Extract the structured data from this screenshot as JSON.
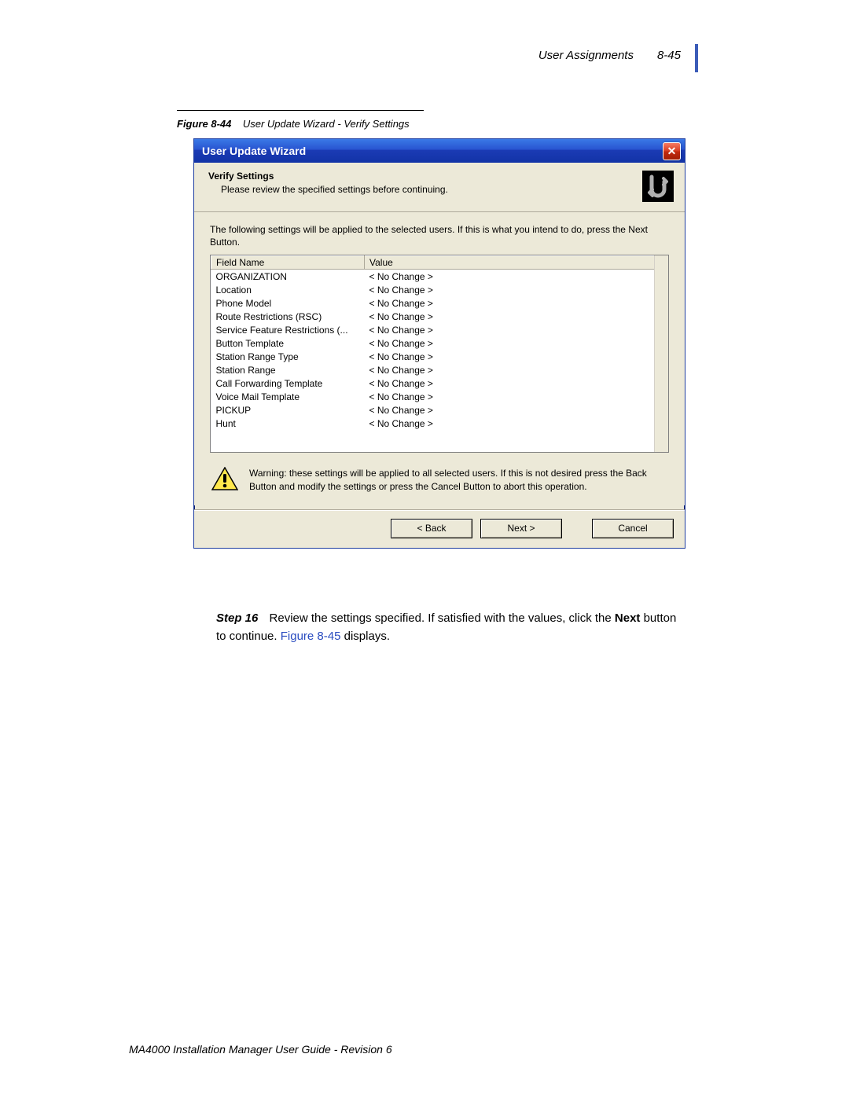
{
  "header": {
    "section": "User Assignments",
    "pageRef": "8-45"
  },
  "figure": {
    "label": "Figure 8-44",
    "caption": "User Update Wizard - Verify Settings"
  },
  "dialog": {
    "title": "User Update Wizard",
    "close_glyph": "✕",
    "heading": "Verify Settings",
    "subheading": "Please review the specified settings before continuing.",
    "intro": "The following settings will be applied to the selected users. If this is what you intend to do, press the Next Button.",
    "columns": {
      "field": "Field Name",
      "value": "Value"
    },
    "rows": [
      {
        "field": "ORGANIZATION",
        "value": "< No Change >"
      },
      {
        "field": "Location",
        "value": "< No Change >"
      },
      {
        "field": "Phone Model",
        "value": "< No Change >"
      },
      {
        "field": "Route Restrictions (RSC)",
        "value": "< No Change >"
      },
      {
        "field": "Service Feature Restrictions (...",
        "value": "< No Change >"
      },
      {
        "field": "Button Template",
        "value": "< No Change >"
      },
      {
        "field": "Station Range Type",
        "value": "< No Change >"
      },
      {
        "field": "Station Range",
        "value": "< No Change >"
      },
      {
        "field": "Call Forwarding Template",
        "value": "< No Change >"
      },
      {
        "field": "Voice Mail Template",
        "value": "< No Change >"
      },
      {
        "field": "PICKUP",
        "value": "< No Change >"
      },
      {
        "field": "Hunt",
        "value": "< No Change >"
      }
    ],
    "warning": "Warning: these settings will be applied to all selected users. If this is not desired press the Back Button and modify the settings or press the Cancel Button to abort this operation.",
    "buttons": {
      "back": "< Back",
      "next": "Next >",
      "cancel": "Cancel"
    }
  },
  "step": {
    "label": "Step  16",
    "text_a": "Review the settings specified. If satisfied with the values, click the ",
    "next_bold": "Next",
    "text_b": " button to continue.  ",
    "figref": "Figure 8-45",
    "text_c": " displays."
  },
  "footer": "MA4000 Installation Manager User Guide - Revision 6"
}
